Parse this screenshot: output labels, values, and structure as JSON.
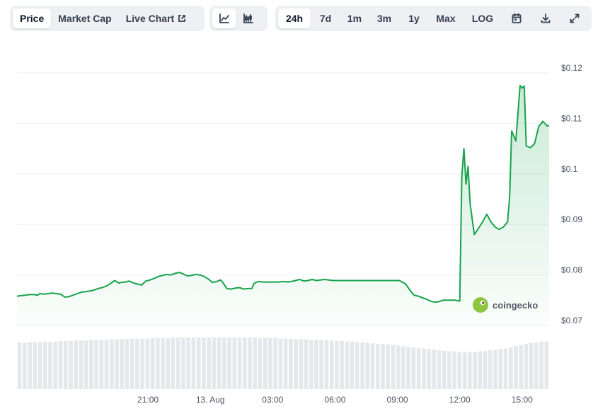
{
  "tabs": {
    "price": "Price",
    "market_cap": "Market Cap",
    "live_chart": "Live Chart"
  },
  "chart_type_icons": [
    "line-chart-icon",
    "candlestick-icon"
  ],
  "ranges": [
    "24h",
    "7d",
    "1m",
    "3m",
    "1y",
    "Max",
    "LOG"
  ],
  "active_range": "24h",
  "tool_icons": [
    "calendar-icon",
    "download-icon",
    "expand-icon"
  ],
  "watermark": "coingecko",
  "colors": {
    "line": "#16a34a",
    "fill": "#16a34a",
    "volume": "#e5e7eb",
    "grid": "#eef0f2"
  },
  "chart_data": {
    "type": "area",
    "title": "",
    "xlabel": "",
    "ylabel": "",
    "ylim": [
      0.07,
      0.12
    ],
    "y_ticks": [
      "$0.12",
      "$0.11",
      "$0.1",
      "$0.09",
      "$0.08",
      "$0.07"
    ],
    "y_tick_values": [
      0.12,
      0.11,
      0.1,
      0.09,
      0.08,
      0.07
    ],
    "x_ticks": [
      "21:00",
      "13. Aug",
      "03:00",
      "06:00",
      "09:00",
      "12:00",
      "15:00"
    ],
    "x_tick_hours": [
      3.9,
      6.9,
      9.9,
      12.9,
      15.9,
      18.9,
      21.9
    ],
    "xlim_hours": [
      -2.4,
      23.2
    ],
    "series": [
      {
        "x": [
          -2.4,
          -2.2,
          -2.0,
          -1.8,
          -1.6,
          -1.4,
          -1.3,
          -1.1,
          -0.9,
          -0.7,
          -0.5,
          -0.3,
          -0.1,
          0.1,
          0.3,
          0.5,
          0.7,
          0.9,
          1.1,
          1.3,
          1.5,
          1.7,
          1.9,
          2.1,
          2.3,
          2.5,
          2.6,
          2.8,
          3.0,
          3.2,
          3.4,
          3.6,
          3.8,
          4.0,
          4.2,
          4.4,
          4.6,
          4.8,
          5.0,
          5.2,
          5.4,
          5.6,
          5.8,
          6.0,
          6.2,
          6.4,
          6.6,
          6.8,
          7.0,
          7.2,
          7.4,
          7.5,
          7.7,
          7.9,
          8.1,
          8.3,
          8.5,
          8.7,
          8.9,
          9.0,
          9.2,
          9.4,
          9.6,
          9.8,
          10.0,
          10.2,
          10.4,
          10.6,
          10.8,
          11.0,
          11.2,
          11.4,
          11.6,
          11.8,
          12.0,
          12.2,
          12.4,
          12.6,
          12.8,
          13.0,
          13.5,
          14.0,
          14.5,
          15.0,
          15.5,
          16.0,
          16.3,
          16.5,
          16.7,
          16.9,
          17.1,
          17.3,
          17.5,
          17.7,
          17.9,
          18.1,
          18.3,
          18.5,
          18.7,
          18.9,
          19.0,
          19.1,
          19.2,
          19.3,
          19.4,
          19.6,
          19.8,
          20.0,
          20.2,
          20.4,
          20.6,
          20.8,
          21.0,
          21.2,
          21.3,
          21.4,
          21.6,
          21.8,
          21.9,
          22.0,
          22.1,
          22.3,
          22.5,
          22.7,
          22.9,
          23.1,
          23.2
        ],
        "values": [
          0.0758,
          0.0759,
          0.076,
          0.0761,
          0.0761,
          0.076,
          0.0763,
          0.0762,
          0.0763,
          0.0764,
          0.0763,
          0.0762,
          0.0756,
          0.0757,
          0.076,
          0.0763,
          0.0766,
          0.0767,
          0.0768,
          0.077,
          0.0773,
          0.0775,
          0.0778,
          0.0783,
          0.0789,
          0.0784,
          0.0785,
          0.0786,
          0.0788,
          0.0784,
          0.0782,
          0.078,
          0.0788,
          0.079,
          0.0793,
          0.0797,
          0.0799,
          0.0801,
          0.08,
          0.0803,
          0.0805,
          0.0802,
          0.0798,
          0.0799,
          0.0801,
          0.08,
          0.0797,
          0.0792,
          0.0785,
          0.0787,
          0.079,
          0.0785,
          0.0773,
          0.0772,
          0.0774,
          0.0775,
          0.0772,
          0.0773,
          0.0773,
          0.0783,
          0.0787,
          0.0786,
          0.0786,
          0.0786,
          0.0786,
          0.0786,
          0.0787,
          0.0786,
          0.0787,
          0.0789,
          0.0791,
          0.0788,
          0.0789,
          0.0791,
          0.0789,
          0.079,
          0.0791,
          0.079,
          0.0789,
          0.0789,
          0.0789,
          0.0789,
          0.0789,
          0.0789,
          0.0789,
          0.0789,
          0.0782,
          0.077,
          0.076,
          0.0758,
          0.0755,
          0.0752,
          0.0748,
          0.0746,
          0.0747,
          0.075,
          0.075,
          0.075,
          0.075,
          0.0748,
          0.0996,
          0.105,
          0.098,
          0.1015,
          0.094,
          0.088,
          0.0892,
          0.0905,
          0.092,
          0.0905,
          0.0895,
          0.089,
          0.0895,
          0.0905,
          0.0955,
          0.1085,
          0.1065,
          0.1175,
          0.117,
          0.1174,
          0.1055,
          0.1052,
          0.106,
          0.1094,
          0.1104,
          0.1095,
          0.1096
        ]
      }
    ],
    "volume_relative": [
      0.8,
      0.8,
      0.81,
      0.81,
      0.81,
      0.82,
      0.82,
      0.82,
      0.83,
      0.83,
      0.83,
      0.84,
      0.84,
      0.84,
      0.85,
      0.85,
      0.85,
      0.85,
      0.86,
      0.86,
      0.86,
      0.86,
      0.87,
      0.87,
      0.87,
      0.87,
      0.88,
      0.88,
      0.88,
      0.88,
      0.89,
      0.89,
      0.89,
      0.89,
      0.89,
      0.89,
      0.89,
      0.89,
      0.89,
      0.89,
      0.89,
      0.89,
      0.89,
      0.89,
      0.89,
      0.89,
      0.89,
      0.88,
      0.88,
      0.88,
      0.88,
      0.87,
      0.87,
      0.87,
      0.86,
      0.86,
      0.86,
      0.85,
      0.85,
      0.85,
      0.84,
      0.84,
      0.83,
      0.83,
      0.82,
      0.82,
      0.81,
      0.81,
      0.8,
      0.79,
      0.78,
      0.78,
      0.77,
      0.76,
      0.75,
      0.74,
      0.73,
      0.72,
      0.71,
      0.7,
      0.69,
      0.68,
      0.67,
      0.66,
      0.65,
      0.65,
      0.64,
      0.64,
      0.64,
      0.64,
      0.65,
      0.66,
      0.67,
      0.68,
      0.69,
      0.7,
      0.72,
      0.74,
      0.76,
      0.78,
      0.8,
      0.8,
      0.82,
      0.82
    ]
  }
}
